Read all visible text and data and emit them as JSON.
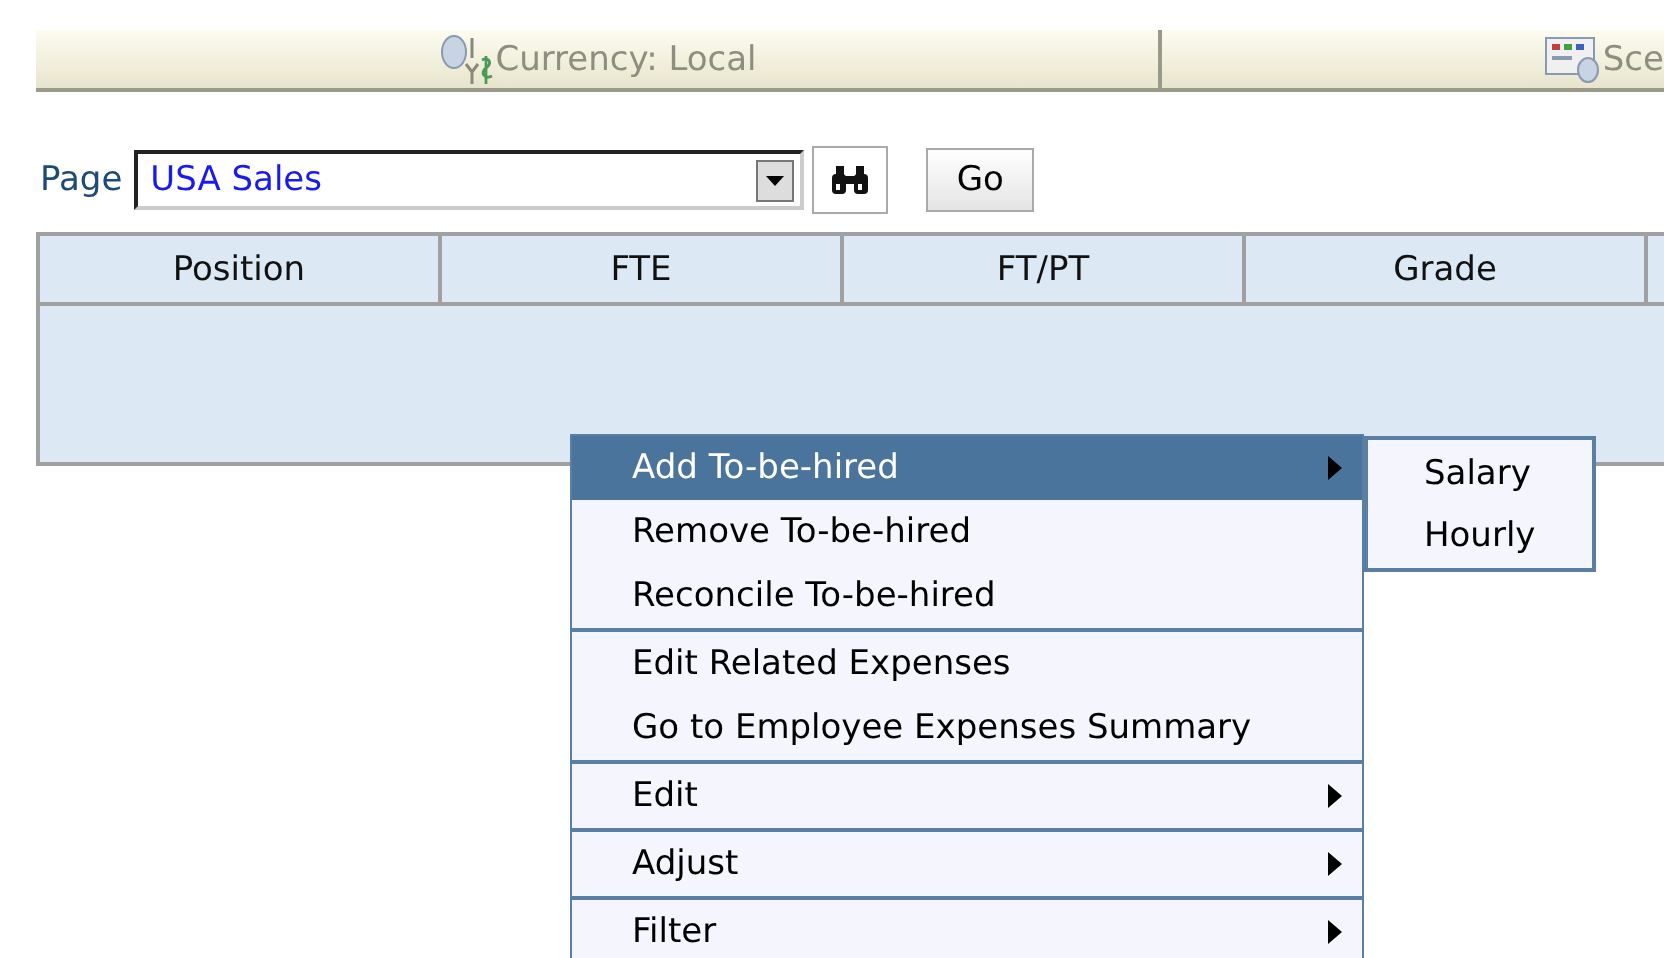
{
  "toolbar": {
    "items": [
      {
        "kind": "currency",
        "label": "Currency: Local"
      },
      {
        "kind": "scenario",
        "label": "Sce"
      }
    ]
  },
  "page_selector": {
    "label": "Page",
    "value": "USA Sales",
    "go_button": "Go"
  },
  "table": {
    "columns": [
      "Position",
      "FTE",
      "FT/PT",
      "Grade"
    ]
  },
  "context_menu": {
    "groups": [
      [
        {
          "label": "Add To-be-hired",
          "has_submenu": true,
          "selected": true
        },
        {
          "label": "Remove To-be-hired",
          "has_submenu": false,
          "selected": false
        },
        {
          "label": "Reconcile To-be-hired",
          "has_submenu": false,
          "selected": false
        }
      ],
      [
        {
          "label": "Edit Related Expenses",
          "has_submenu": false,
          "selected": false
        },
        {
          "label": "Go to Employee Expenses Summary",
          "has_submenu": false,
          "selected": false
        }
      ],
      [
        {
          "label": "Edit",
          "has_submenu": true,
          "selected": false
        }
      ],
      [
        {
          "label": "Adjust",
          "has_submenu": true,
          "selected": false
        }
      ],
      [
        {
          "label": "Filter",
          "has_submenu": true,
          "selected": false
        }
      ]
    ]
  },
  "submenu": {
    "items": [
      {
        "label": "Salary",
        "selected": false
      },
      {
        "label": "Hourly",
        "selected": false
      }
    ]
  }
}
